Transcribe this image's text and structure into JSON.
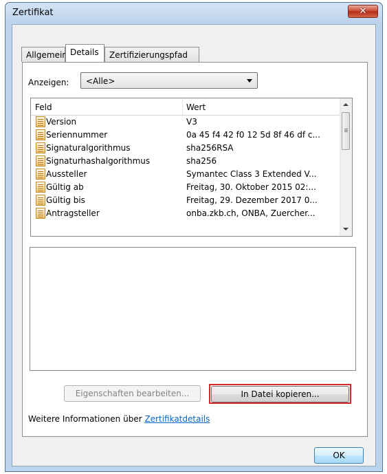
{
  "window": {
    "title": "Zertifikat",
    "close_symbol": "✕"
  },
  "tabs": [
    {
      "label": "Allgemein",
      "active": false
    },
    {
      "label": "Details",
      "active": true
    },
    {
      "label": "Zertifizierungspfad",
      "active": false
    }
  ],
  "show": {
    "label": "Anzeigen:",
    "selected": "<Alle>"
  },
  "fieldlist": {
    "columns": [
      "Feld",
      "Wert"
    ],
    "rows": [
      {
        "field": "Version",
        "value": "V3"
      },
      {
        "field": "Seriennummer",
        "value": "0a 45 f4 42 f0 12 5d 8f 46 df c..."
      },
      {
        "field": "Signaturalgorithmus",
        "value": "sha256RSA"
      },
      {
        "field": "Signaturhashalgorithmus",
        "value": "sha256"
      },
      {
        "field": "Aussteller",
        "value": "Symantec Class 3 Extended V..."
      },
      {
        "field": "Gültig ab",
        "value": "Freitag, 30. Oktober 2015 02:..."
      },
      {
        "field": "Gültig bis",
        "value": "Freitag, 29. Dezember 2017 0..."
      },
      {
        "field": "Antragsteller",
        "value": "onba.zkb.ch, ONBA, Zuercher..."
      }
    ]
  },
  "buttons": {
    "edit_properties": "Eigenschaften bearbeiten...",
    "copy_to_file": "In Datei kopieren...",
    "ok": "OK"
  },
  "more_info": {
    "prefix": "Weitere Informationen über ",
    "link": "Zertifikatdetails"
  },
  "colors": {
    "highlight": "#d7262c",
    "link": "#0066cc",
    "close_button": "#c9452e"
  }
}
